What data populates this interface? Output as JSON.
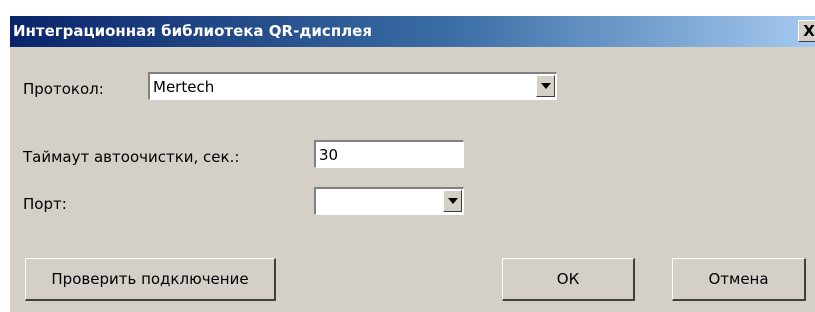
{
  "window": {
    "title": "Интеграционная библиотека QR-дисплея",
    "close_glyph": "X"
  },
  "form": {
    "protocol_label": "Протокол:",
    "protocol_value": "Mertech",
    "timeout_label": "Таймаут автоочистки, сек.:",
    "timeout_value": "30",
    "port_label": "Порт:",
    "port_value": ""
  },
  "buttons": {
    "check_connection": "Проверить подключение",
    "ok": "ОК",
    "cancel": "Отмена"
  },
  "icons": {
    "close": "close-icon",
    "dropdown": "chevron-down-icon"
  }
}
